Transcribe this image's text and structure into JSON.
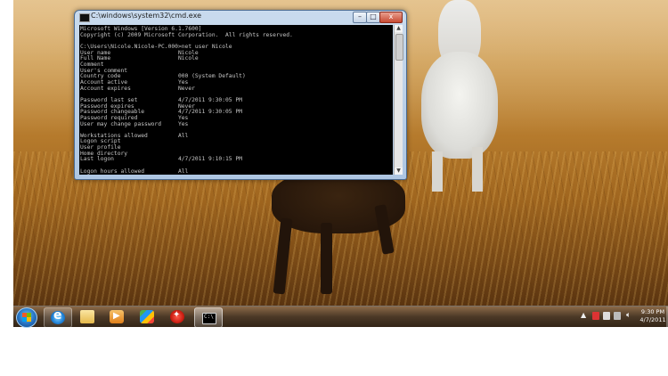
{
  "window": {
    "title": "C:\\windows\\system32\\cmd.exe",
    "minimize": "–",
    "maximize": "□",
    "close": "x",
    "console_lines": [
      "Microsoft Windows [Version 6.1.7600]",
      "Copyright (c) 2009 Microsoft Corporation.  All rights reserved.",
      "",
      "C:\\Users\\Nicole.Nicole-PC.000>net user Nicole",
      "User name                    Nicole",
      "Full Name                    Nicole",
      "Comment",
      "User's comment",
      "Country code                 000 (System Default)",
      "Account active               Yes",
      "Account expires              Never",
      "",
      "Password last set            4/7/2011 9:30:05 PM",
      "Password expires             Never",
      "Password changeable          4/7/2011 9:30:05 PM",
      "Password required            Yes",
      "User may change password     Yes",
      "",
      "Workstations allowed         All",
      "Logon script",
      "User profile",
      "Home directory",
      "Last logon                   4/7/2011 9:10:15 PM",
      "",
      "Logon hours allowed          All"
    ]
  },
  "taskbar": {
    "icons": [
      "windows-start-icon",
      "internet-explorer-icon",
      "folder-icon",
      "media-player-icon",
      "windows-live-icon",
      "red-app-icon",
      "cmd-icon"
    ],
    "tray": {
      "show_hidden": "▲",
      "clock_time": "9:30 PM",
      "clock_date": "4/7/2011"
    }
  }
}
